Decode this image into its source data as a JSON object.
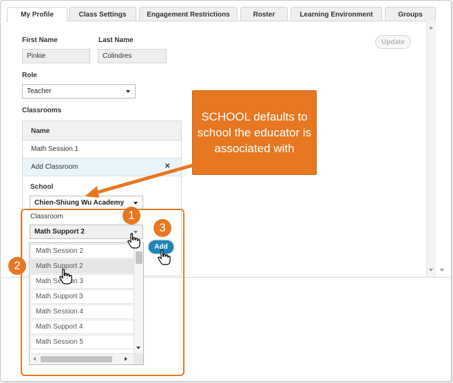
{
  "tabs": [
    {
      "label": "My Profile",
      "active": true
    },
    {
      "label": "Class Settings"
    },
    {
      "label": "Engagement Restrictions"
    },
    {
      "label": "Roster"
    },
    {
      "label": "Learning Environment"
    },
    {
      "label": "Groups"
    }
  ],
  "profile": {
    "first_name_label": "First Name",
    "first_name_value": "Pinkie",
    "last_name_label": "Last Name",
    "last_name_value": "Colindres",
    "role_label": "Role",
    "role_value": "Teacher",
    "update_label": "Update"
  },
  "classrooms": {
    "section_label": "Classrooms",
    "header": "Name",
    "rows": [
      "Math Session 1",
      "Add Classroom"
    ],
    "school_label": "School",
    "school_value": "Chien-Shiung Wu Academy",
    "classroom_label": "Classroom",
    "classroom_value": "Math Support 2",
    "add_label": "Add",
    "options": [
      "Math Session 2",
      "Math Support 2",
      "Math Session 3",
      "Math Support 3",
      "Math Session 4",
      "Math Support 4",
      "Math Session 5"
    ]
  },
  "annotations": {
    "callout": "SCHOOL defaults to school the educator is associated with",
    "badge1": "1",
    "badge2": "2",
    "badge3": "3"
  },
  "colors": {
    "accent_orange": "#e87722",
    "add_button_blue": "#1f86b8"
  },
  "icons": {
    "dropdown_caret": "chevron-down-icon",
    "close": "close-icon",
    "pointer": "hand-pointer-icon"
  }
}
